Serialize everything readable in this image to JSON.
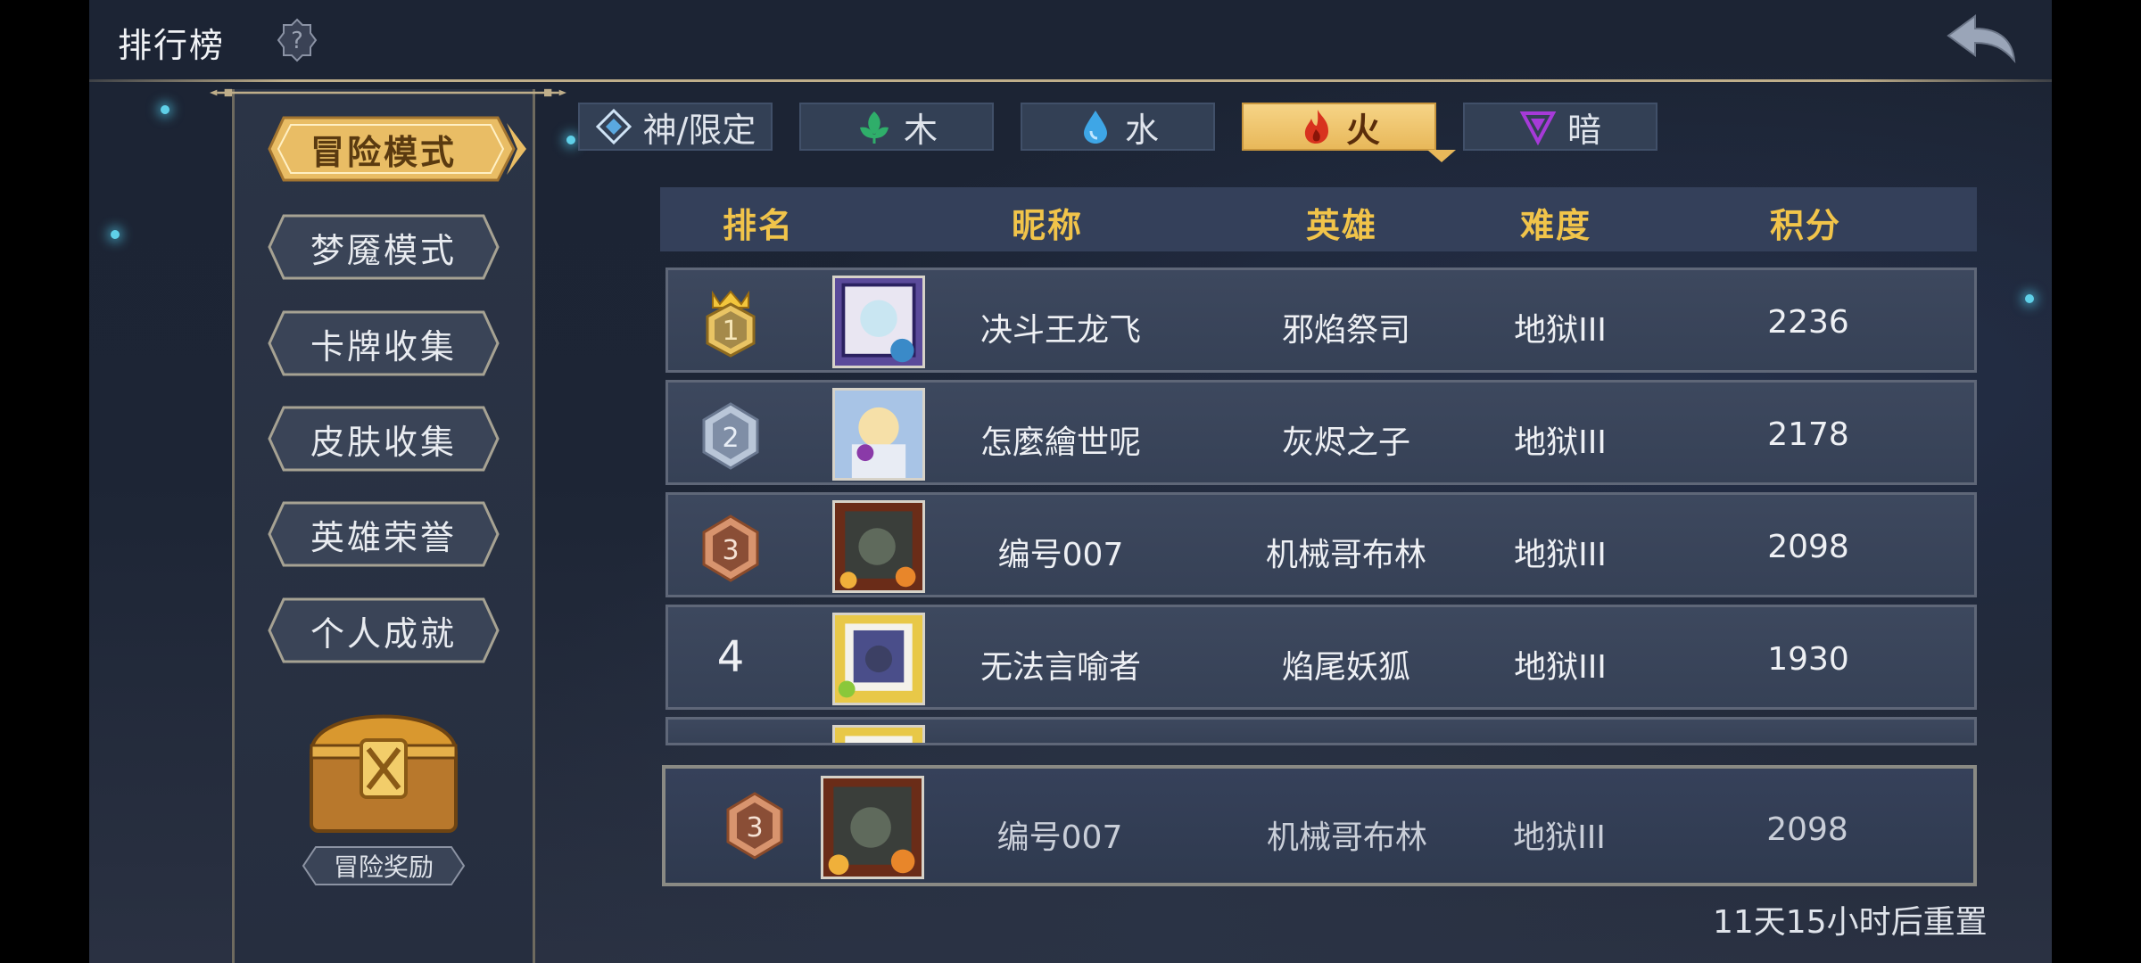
{
  "header": {
    "title": "排行榜"
  },
  "sidebar": {
    "modes": [
      {
        "label": "冒险模式",
        "active": true
      },
      {
        "label": "梦魇模式",
        "active": false
      },
      {
        "label": "卡牌收集",
        "active": false
      },
      {
        "label": "皮肤收集",
        "active": false
      },
      {
        "label": "英雄荣誉",
        "active": false
      },
      {
        "label": "个人成就",
        "active": false
      }
    ],
    "reward_label": "冒险奖励"
  },
  "tabs": [
    {
      "label": "神/限定",
      "icon": "diamond-icon",
      "active": false
    },
    {
      "label": "木",
      "icon": "leaf-icon",
      "active": false
    },
    {
      "label": "水",
      "icon": "water-drop-icon",
      "active": false
    },
    {
      "label": "火",
      "icon": "fire-icon",
      "active": true
    },
    {
      "label": "暗",
      "icon": "dark-triangle-icon",
      "active": false
    }
  ],
  "table": {
    "columns": [
      "排名",
      "昵称",
      "英雄",
      "难度",
      "积分"
    ],
    "rows": [
      {
        "rank": "1",
        "nickname": "决斗王龙飞",
        "hero": "邪焰祭司",
        "difficulty": "地狱III",
        "score": "2236"
      },
      {
        "rank": "2",
        "nickname": "怎麼繪世呢",
        "hero": "灰烬之子",
        "difficulty": "地狱III",
        "score": "2178"
      },
      {
        "rank": "3",
        "nickname": "编号007",
        "hero": "机械哥布林",
        "difficulty": "地狱III",
        "score": "2098"
      },
      {
        "rank": "4",
        "nickname": "无法言喻者",
        "hero": "焰尾妖狐",
        "difficulty": "地狱III",
        "score": "1930"
      }
    ]
  },
  "my_entry": {
    "rank": "3",
    "nickname": "编号007",
    "hero": "机械哥布林",
    "difficulty": "地狱III",
    "score": "2098"
  },
  "footer": {
    "reset_text": "11天15小时后重置"
  },
  "colors": {
    "accent_gold": "#f1c44a",
    "active_tab": "#e8b85a",
    "panel": "#34405a"
  }
}
